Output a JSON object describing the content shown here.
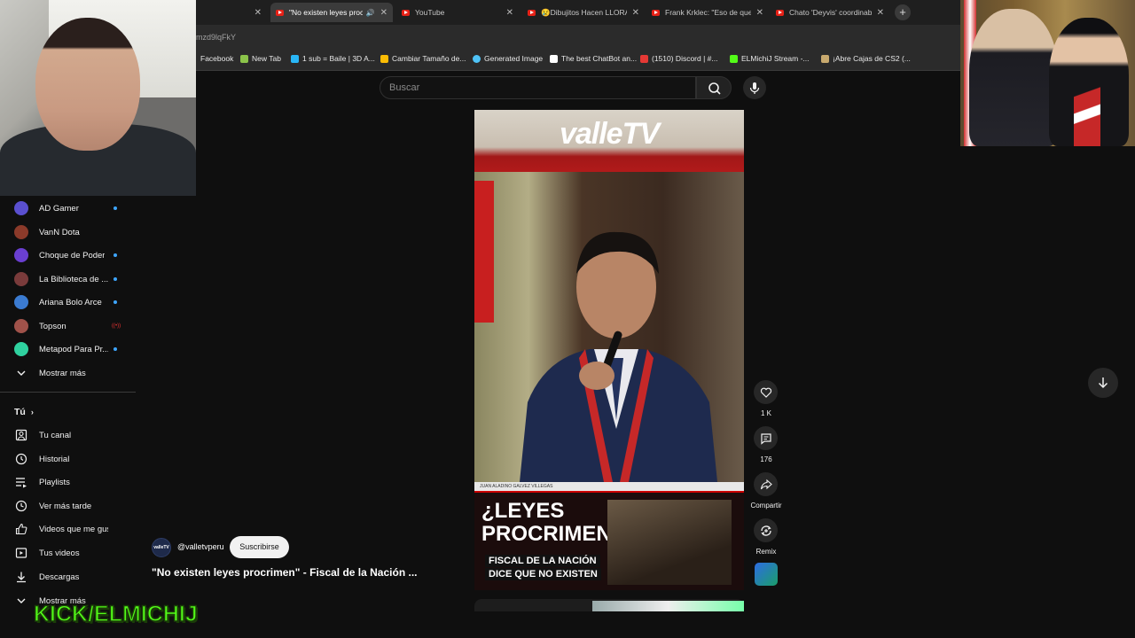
{
  "browser": {
    "tabs": [
      {
        "title": "",
        "active": false
      },
      {
        "title": "\"No existen leyes proc",
        "active": true,
        "muted_icon": "🔊"
      },
      {
        "title": "YouTube",
        "active": false
      },
      {
        "title": "😢Dibujitos Hacen LLORA",
        "active": false
      },
      {
        "title": "Frank Krklec: \"Eso de que",
        "active": false
      },
      {
        "title": "Chato 'Deyvis' coordinaba",
        "active": false
      }
    ],
    "new_tab": "+",
    "url_fragment": "mzd9lqFkY",
    "bookmarks": [
      {
        "label": "Facebook",
        "color": "#1877f2"
      },
      {
        "label": "New Tab",
        "color": "#8bc34a"
      },
      {
        "label": "1 sub = Baile | 3D A...",
        "color": "#29b6f6"
      },
      {
        "label": "Cambiar Tamaño de...",
        "color": "#fbbc04"
      },
      {
        "label": "Generated Image",
        "color": "#4fc3f7"
      },
      {
        "label": "The best ChatBot an...",
        "color": "#ffffff"
      },
      {
        "label": "(1510) Discord | #...",
        "color": "#e53935"
      },
      {
        "label": "ELMichiJ Stream -...",
        "color": "#53fc18"
      },
      {
        "label": "¡Abre Cajas de CS2 (...",
        "color": "#c8a96e"
      }
    ]
  },
  "search": {
    "placeholder": "Buscar"
  },
  "sidebar": {
    "subscriptions": [
      {
        "label": "AD Gamer",
        "color": "#5a4fcf",
        "status": "dot"
      },
      {
        "label": "VanN Dota",
        "color": "#8b3a2a",
        "status": ""
      },
      {
        "label": "Choque de Poder",
        "color": "#6a3fd1",
        "status": "dot"
      },
      {
        "label": "La Biblioteca de ...",
        "color": "#7a3b3b",
        "status": "dot"
      },
      {
        "label": "Ariana Bolo Arce",
        "color": "#3b7bd1",
        "status": "dot"
      },
      {
        "label": "Topson",
        "color": "#a0524a",
        "status": "live"
      },
      {
        "label": "Metapod Para Pr...",
        "color": "#2fd19f",
        "status": "dot"
      }
    ],
    "show_more_1": "Mostrar más",
    "you_section": "Tú",
    "you_items": [
      {
        "label": "Tu canal",
        "icon": "channel-icon"
      },
      {
        "label": "Historial",
        "icon": "history-icon"
      },
      {
        "label": "Playlists",
        "icon": "playlists-icon"
      },
      {
        "label": "Ver más tarde",
        "icon": "watch-later-icon"
      },
      {
        "label": "Videos que me gus...",
        "icon": "like-icon"
      },
      {
        "label": "Tus videos",
        "icon": "your-videos-icon"
      },
      {
        "label": "Descargas",
        "icon": "download-icon"
      }
    ],
    "show_more_2": "Mostrar más"
  },
  "short": {
    "logo": "valleTV",
    "caption_line1": "¿LEYES",
    "caption_line2": "PROCRIMEN?",
    "caption_sub1": "FISCAL DE LA NACIÓN",
    "caption_sub2": "DICE QUE NO EXISTEN",
    "nameplate": "JUAN ALADINO GALVEZ VILLEGAS"
  },
  "actions": {
    "like_count": "1 K",
    "comment_count": "176",
    "share_label": "Compartir",
    "remix_label": "Remix"
  },
  "channel": {
    "handle": "@valletvperu",
    "avatar_text": "valleTV",
    "subscribe_label": "Suscribirse"
  },
  "video": {
    "title": "\"No existen leyes procrimen\" - Fiscal de la Nación ..."
  },
  "overlay": {
    "streamer_tag": "KICK/ELMICHIJ"
  }
}
